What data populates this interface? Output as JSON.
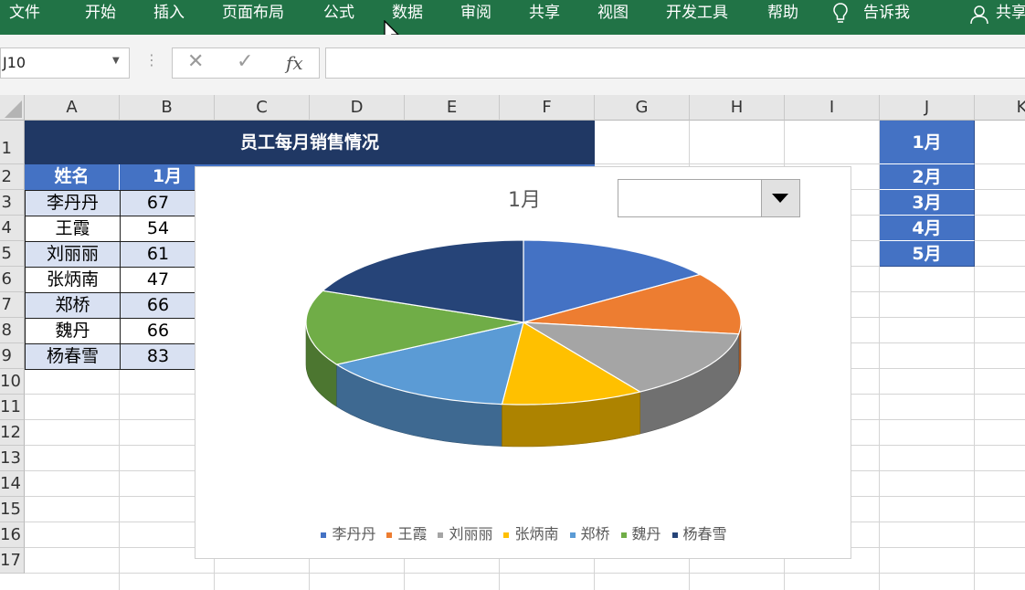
{
  "ribbon": {
    "tabs": [
      "文件",
      "开始",
      "插入",
      "页面布局",
      "公式",
      "数据",
      "审阅",
      "共享",
      "视图",
      "开发工具",
      "帮助",
      "告诉我",
      "共享"
    ]
  },
  "formula_bar": {
    "name_box": "J10",
    "cancel_label": "✕",
    "enter_label": "✓",
    "fx_label": "fx",
    "formula_value": ""
  },
  "columns": [
    "A",
    "B",
    "C",
    "D",
    "E",
    "F",
    "G",
    "H",
    "I",
    "J",
    "K"
  ],
  "rows": [
    "1",
    "2",
    "3",
    "4",
    "5",
    "6",
    "7",
    "8",
    "9",
    "10",
    "11",
    "12",
    "13",
    "14",
    "15",
    "16",
    "17"
  ],
  "sheet": {
    "title": "员工每月销售情况",
    "header_name": "姓名",
    "header_month": "1月",
    "table": [
      {
        "name": "李丹丹",
        "value": "67"
      },
      {
        "name": "王霞",
        "value": "54"
      },
      {
        "name": "刘丽丽",
        "value": "61"
      },
      {
        "name": "张炳南",
        "value": "47"
      },
      {
        "name": "郑桥",
        "value": "66"
      },
      {
        "name": "魏丹",
        "value": "66"
      },
      {
        "name": "杨春雪",
        "value": "83"
      }
    ],
    "month_list": [
      "1月",
      "2月",
      "3月",
      "4月",
      "5月"
    ]
  },
  "chart_data": {
    "type": "pie",
    "title": "1月",
    "categories": [
      "李丹丹",
      "王霞",
      "刘丽丽",
      "张炳南",
      "郑桥",
      "魏丹",
      "杨春雪"
    ],
    "values": [
      67,
      54,
      61,
      47,
      66,
      66,
      83
    ],
    "colors": [
      "#4472c4",
      "#ed7d31",
      "#a5a5a5",
      "#ffc000",
      "#5b9bd5",
      "#70ad47",
      "#264478"
    ],
    "legend": "bottom",
    "three_d": true
  },
  "colors": {
    "ribbon": "#217346",
    "title_fill": "#203864",
    "header_fill": "#4472c4",
    "band_fill": "#d9e1f2"
  }
}
